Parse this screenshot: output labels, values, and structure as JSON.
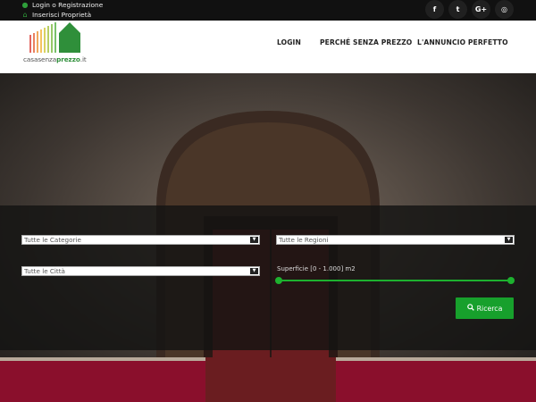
{
  "topbar": {
    "login_text": "Login o Registrazione",
    "insert_text": "Inserisci Proprietà",
    "login_icon": "user-icon",
    "insert_icon": "home-icon",
    "social": [
      {
        "icon": "facebook-icon",
        "glyph": "f"
      },
      {
        "icon": "twitter-icon",
        "glyph": "t"
      },
      {
        "icon": "google-plus-icon",
        "glyph": "G+"
      },
      {
        "icon": "instagram-icon",
        "glyph": "◎"
      }
    ]
  },
  "header": {
    "logo_text_a": "casasenza",
    "logo_text_b": "prezzo",
    "logo_text_c": ".it",
    "nav": [
      "LOGIN",
      "PERCHÉ SENZA PREZZO",
      "L'ANNUNCIO PERFETTO"
    ]
  },
  "search": {
    "category": "Tutte le Categorie",
    "region": "Tutte le Regioni",
    "city": "Tutte le Città",
    "range_label": "Superficie [0 - 1.000] m2",
    "range": {
      "min": 0,
      "max": 1000,
      "unit": "m2"
    },
    "button_label": "Ricerca",
    "button_icon": "search-icon"
  },
  "colors": {
    "accent": "#17a02c",
    "topbar": "#111111",
    "panel": "#141412"
  }
}
